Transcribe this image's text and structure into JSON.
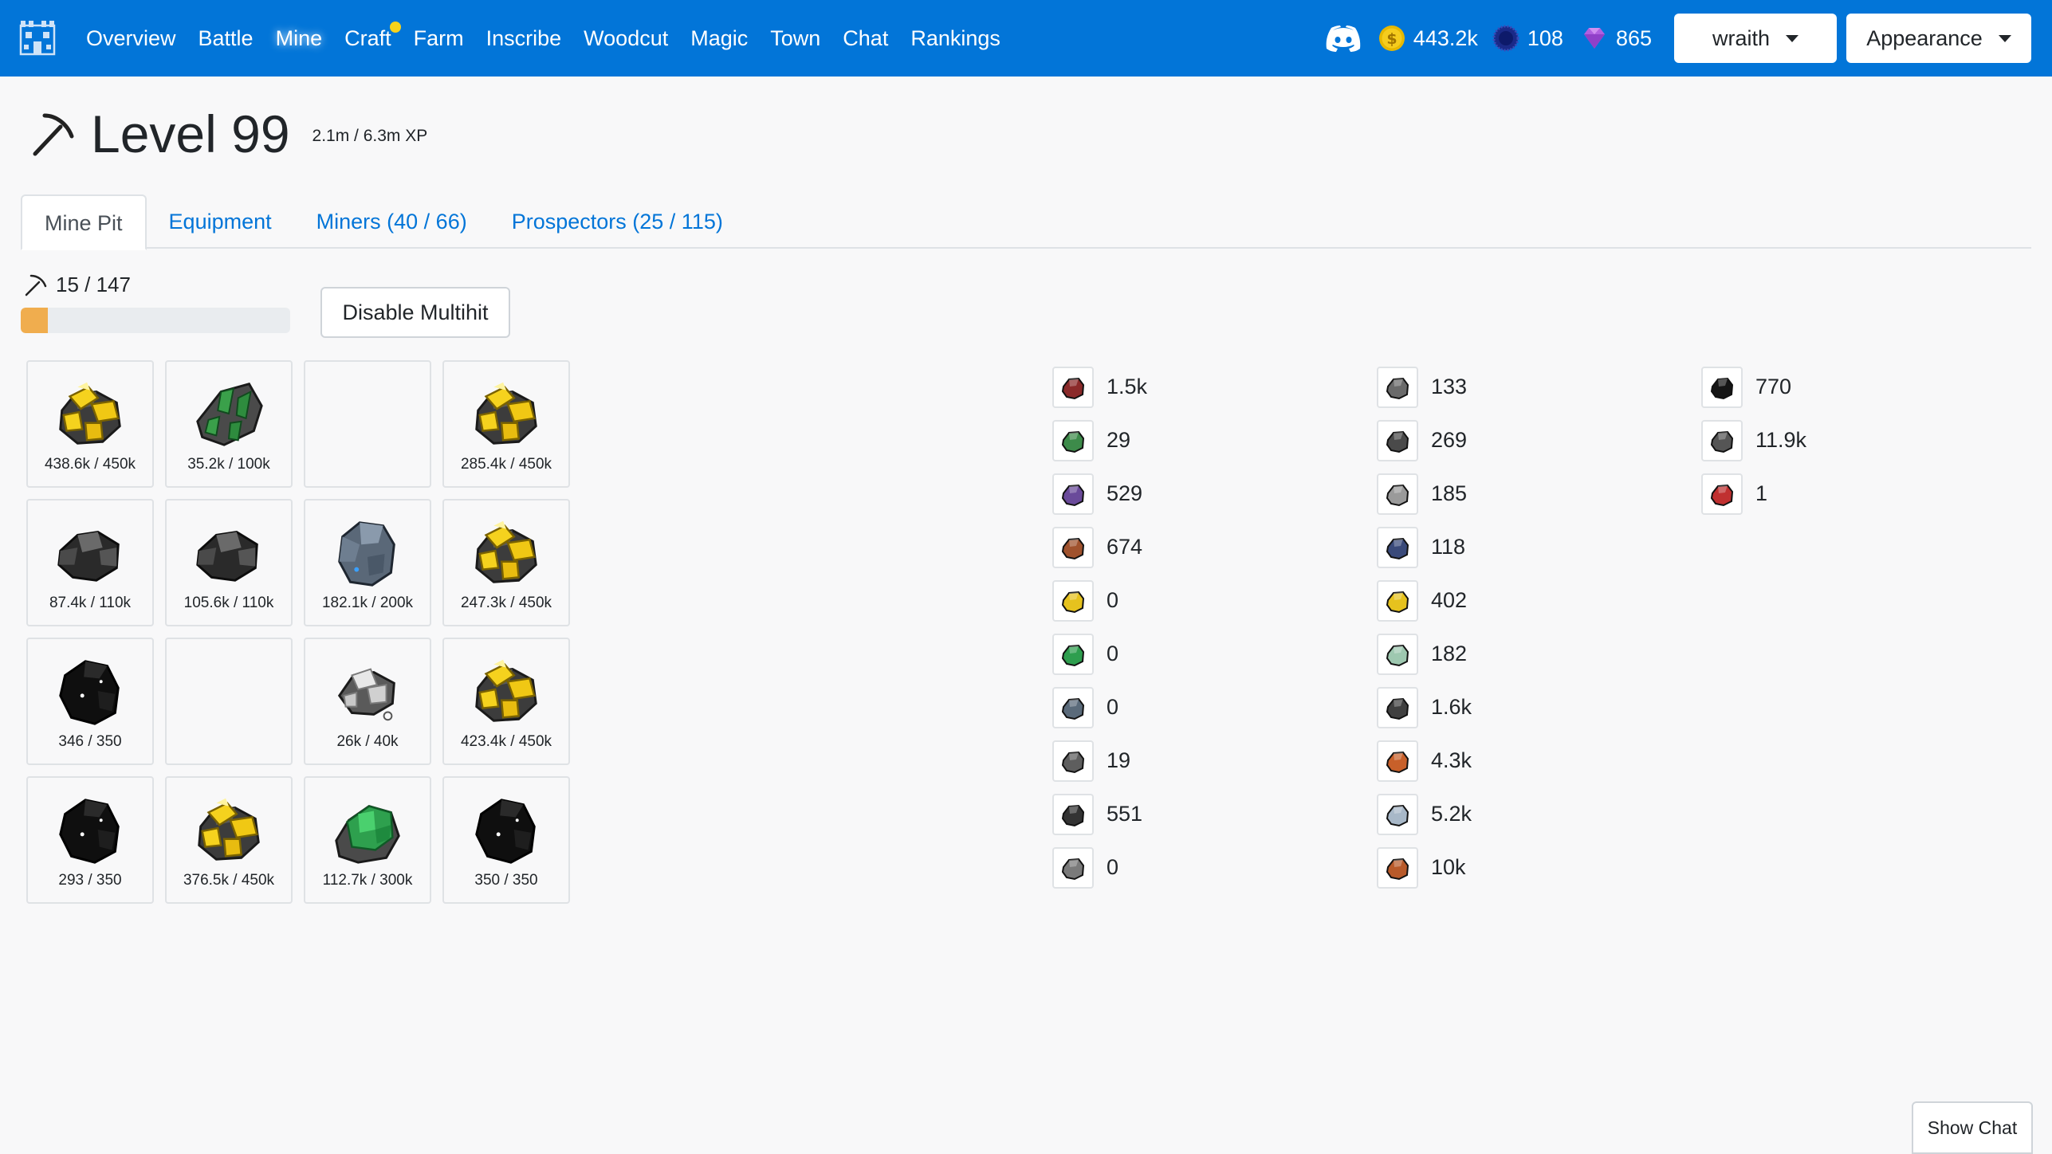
{
  "nav": {
    "links": [
      {
        "label": "Overview"
      },
      {
        "label": "Battle"
      },
      {
        "label": "Mine"
      },
      {
        "label": "Craft"
      },
      {
        "label": "Farm"
      },
      {
        "label": "Inscribe"
      },
      {
        "label": "Woodcut"
      },
      {
        "label": "Magic"
      },
      {
        "label": "Town"
      },
      {
        "label": "Chat"
      },
      {
        "label": "Rankings"
      }
    ],
    "active": "Mine",
    "notify_on": "Craft",
    "currencies": {
      "gold": "443.2k",
      "orbs": "108",
      "gems": "865"
    },
    "user_menu": "wraith",
    "appearance_menu": "Appearance"
  },
  "header": {
    "level": "Level 99",
    "xp": "2.1m / 6.3m XP"
  },
  "tabs": [
    {
      "label": "Mine Pit"
    },
    {
      "label": "Equipment"
    },
    {
      "label": "Miners (40 / 66)"
    },
    {
      "label": "Prospectors (25 / 115)"
    }
  ],
  "progress": {
    "label": "15 / 147",
    "fraction": 0.102
  },
  "multihit_button": "Disable Multihit",
  "mine_cells": [
    {
      "ore": "gold-ore",
      "count": "438.6k / 450k"
    },
    {
      "ore": "emerald-ore",
      "count": "35.2k / 100k"
    },
    {
      "ore": "empty",
      "count": ""
    },
    {
      "ore": "gold-ore",
      "count": "285.4k / 450k"
    },
    {
      "ore": "coal-ore",
      "count": "87.4k / 110k"
    },
    {
      "ore": "coal-ore",
      "count": "105.6k / 110k"
    },
    {
      "ore": "iron-ore",
      "count": "182.1k / 200k"
    },
    {
      "ore": "gold-ore",
      "count": "247.3k / 450k"
    },
    {
      "ore": "obsidian-ore",
      "count": "346 / 350"
    },
    {
      "ore": "empty",
      "count": ""
    },
    {
      "ore": "silver-ore",
      "count": "26k / 40k"
    },
    {
      "ore": "gold-ore",
      "count": "423.4k / 450k"
    },
    {
      "ore": "obsidian-ore",
      "count": "293 / 350"
    },
    {
      "ore": "gold-ore",
      "count": "376.5k / 450k"
    },
    {
      "ore": "jade-ore",
      "count": "112.7k / 300k"
    },
    {
      "ore": "obsidian-ore",
      "count": "350 / 350"
    }
  ],
  "inventory": {
    "col1": [
      {
        "icon": "ruby-ore-icon",
        "color": "#8b2a2a",
        "value": "1.5k"
      },
      {
        "icon": "emerald-ore-icon",
        "color": "#3d8b4a",
        "value": "29"
      },
      {
        "icon": "amethyst-ore-icon",
        "color": "#6a4a9a",
        "value": "529"
      },
      {
        "icon": "copper-ore-icon",
        "color": "#a0522d",
        "value": "674"
      },
      {
        "icon": "gold-nugget-icon",
        "color": "#e6c21e",
        "value": "0"
      },
      {
        "icon": "jade-ore-icon",
        "color": "#2e9e4e",
        "value": "0"
      },
      {
        "icon": "iron-ore-icon",
        "color": "#5a6a7a",
        "value": "0"
      },
      {
        "icon": "stone-ore-icon",
        "color": "#5e5e5e",
        "value": "19"
      },
      {
        "icon": "coal-ore-icon",
        "color": "#333333",
        "value": "551"
      },
      {
        "icon": "tin-ore-icon",
        "color": "#7a7a7a",
        "value": "0"
      }
    ],
    "col2": [
      {
        "icon": "granite-ore-icon",
        "color": "#6a6a6a",
        "value": "133"
      },
      {
        "icon": "lead-ore-icon",
        "color": "#4a4a4a",
        "value": "269"
      },
      {
        "icon": "silver-ore-icon",
        "color": "#9a9a9a",
        "value": "185"
      },
      {
        "icon": "cobalt-ore-icon",
        "color": "#3a4a7a",
        "value": "118"
      },
      {
        "icon": "gold-bar-icon",
        "color": "#e6c21e",
        "value": "402"
      },
      {
        "icon": "mithril-ore-icon",
        "color": "#9ec8b0",
        "value": "182"
      },
      {
        "icon": "graphite-ore-icon",
        "color": "#404040",
        "value": "1.6k"
      },
      {
        "icon": "copper-chunk-icon",
        "color": "#c8602a",
        "value": "4.3k"
      },
      {
        "icon": "quartz-ore-icon",
        "color": "#a8b8c8",
        "value": "5.2k"
      },
      {
        "icon": "bronze-ore-icon",
        "color": "#b85a2a",
        "value": "10k"
      }
    ],
    "col3": [
      {
        "icon": "obsidian-chunk-icon",
        "color": "#151515",
        "value": "770"
      },
      {
        "icon": "pebble-icon",
        "color": "#555555",
        "value": "11.9k"
      },
      {
        "icon": "red-ore-icon",
        "color": "#c03030",
        "value": "1"
      }
    ]
  },
  "show_chat": "Show Chat"
}
